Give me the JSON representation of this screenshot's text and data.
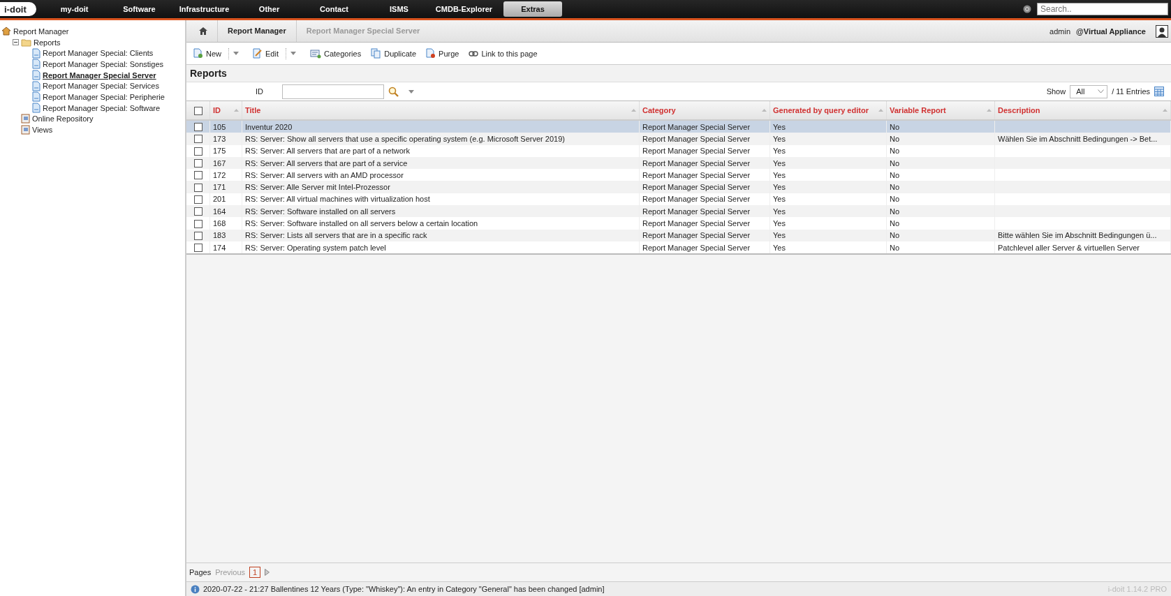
{
  "top_nav": {
    "logo": "i-doit",
    "items": [
      {
        "label": "my-doit",
        "selected": false
      },
      {
        "label": "Software",
        "selected": false
      },
      {
        "label": "Infrastructure",
        "selected": false
      },
      {
        "label": "Other",
        "selected": false
      },
      {
        "label": "Contact",
        "selected": false
      },
      {
        "label": "ISMS",
        "selected": false
      },
      {
        "label": "CMDB-Explorer",
        "selected": false
      },
      {
        "label": "Extras",
        "selected": true
      }
    ],
    "search": {
      "placeholder": "Search.."
    }
  },
  "sidebar": {
    "tree": [
      {
        "label": "Report Manager",
        "kind": "home",
        "children": [
          {
            "label": "Reports",
            "kind": "folder",
            "expanded": true,
            "children": [
              {
                "label": "Report Manager Special: Clients",
                "kind": "report",
                "selected": false
              },
              {
                "label": "Report Manager Special: Sonstiges",
                "kind": "report",
                "selected": false
              },
              {
                "label": "Report Manager Special Server",
                "kind": "report",
                "selected": true
              },
              {
                "label": "Report Manager Special: Services",
                "kind": "report",
                "selected": false
              },
              {
                "label": "Report Manager Special: Peripherie",
                "kind": "report",
                "selected": false
              },
              {
                "label": "Report Manager Special: Software",
                "kind": "report",
                "selected": false
              }
            ]
          },
          {
            "label": "Online Repository",
            "kind": "book"
          },
          {
            "label": "Views",
            "kind": "book"
          }
        ]
      }
    ]
  },
  "breadcrumb": [
    "Report Manager",
    "Report Manager Special Server"
  ],
  "user": {
    "name": "admin",
    "tenant": "@Virtual Appliance"
  },
  "toolbar": [
    {
      "kind": "new",
      "label": "New"
    },
    {
      "kind": "dropdown"
    },
    {
      "kind": "edit",
      "label": "Edit"
    },
    {
      "kind": "dropdown"
    },
    {
      "kind": "categories",
      "label": "Categories"
    },
    {
      "kind": "duplicate",
      "label": "Duplicate"
    },
    {
      "kind": "purge",
      "label": "Purge"
    },
    {
      "kind": "link",
      "label": "Link to this page"
    }
  ],
  "page_title": "Reports",
  "filter": {
    "label": "ID",
    "show_label": "Show",
    "show_value": "All",
    "entries": "/ 11 Entries"
  },
  "table": {
    "select_all_checked": false,
    "columns": [
      "ID",
      "Title",
      "Category",
      "Generated by query editor",
      "Variable Report",
      "Description"
    ],
    "rows": [
      {
        "cells": [
          "105",
          "Inventur 2020",
          "Report Manager Special Server",
          "Yes",
          "No",
          ""
        ],
        "selected": true,
        "checked": false
      },
      {
        "cells": [
          "173",
          "RS: Server: Show all servers that use a specific operating system (e.g. Microsoft Server 2019)",
          "Report Manager Special Server",
          "Yes",
          "No",
          "Wählen Sie im Abschnitt Bedingungen -> Bet..."
        ],
        "selected": false,
        "checked": false
      },
      {
        "cells": [
          "175",
          "RS: Server: All servers that are part of a network",
          "Report Manager Special Server",
          "Yes",
          "No",
          ""
        ],
        "selected": false,
        "checked": false
      },
      {
        "cells": [
          "167",
          "RS: Server: All servers that are part of a service",
          "Report Manager Special Server",
          "Yes",
          "No",
          ""
        ],
        "selected": false,
        "checked": false
      },
      {
        "cells": [
          "172",
          "RS: Server: All servers with an AMD processor",
          "Report Manager Special Server",
          "Yes",
          "No",
          ""
        ],
        "selected": false,
        "checked": false
      },
      {
        "cells": [
          "171",
          "RS: Server: Alle Server mit Intel-Prozessor",
          "Report Manager Special Server",
          "Yes",
          "No",
          ""
        ],
        "selected": false,
        "checked": false
      },
      {
        "cells": [
          "201",
          "RS: Server: All virtual machines with virtualization host",
          "Report Manager Special Server",
          "Yes",
          "No",
          ""
        ],
        "selected": false,
        "checked": false
      },
      {
        "cells": [
          "164",
          "RS: Server: Software installed on all servers",
          "Report Manager Special Server",
          "Yes",
          "No",
          ""
        ],
        "selected": false,
        "checked": false
      },
      {
        "cells": [
          "168",
          "RS: Server: Software installed on all servers below a certain location",
          "Report Manager Special Server",
          "Yes",
          "No",
          ""
        ],
        "selected": false,
        "checked": false
      },
      {
        "cells": [
          "183",
          "RS: Server: Lists all servers that are in a specific rack",
          "Report Manager Special Server",
          "Yes",
          "No",
          "Bitte wählen Sie im Abschnitt Bedingungen ü..."
        ],
        "selected": false,
        "checked": false
      },
      {
        "cells": [
          "174",
          "RS: Server: Operating system patch level",
          "Report Manager Special Server",
          "Yes",
          "No",
          "Patchlevel aller Server & virtuellen Server"
        ],
        "selected": false,
        "checked": false
      }
    ]
  },
  "pager": {
    "label": "Pages",
    "previous": "Previous",
    "pages": [
      {
        "label": "1",
        "selected": true
      }
    ]
  },
  "status_bar": {
    "message": "2020-07-22 - 21:27 Ballentines 12 Years (Type: \"Whiskey\"): An entry in Category \"General\" has been changed [admin]",
    "version": "i-doit 1.14.2 PRO"
  }
}
